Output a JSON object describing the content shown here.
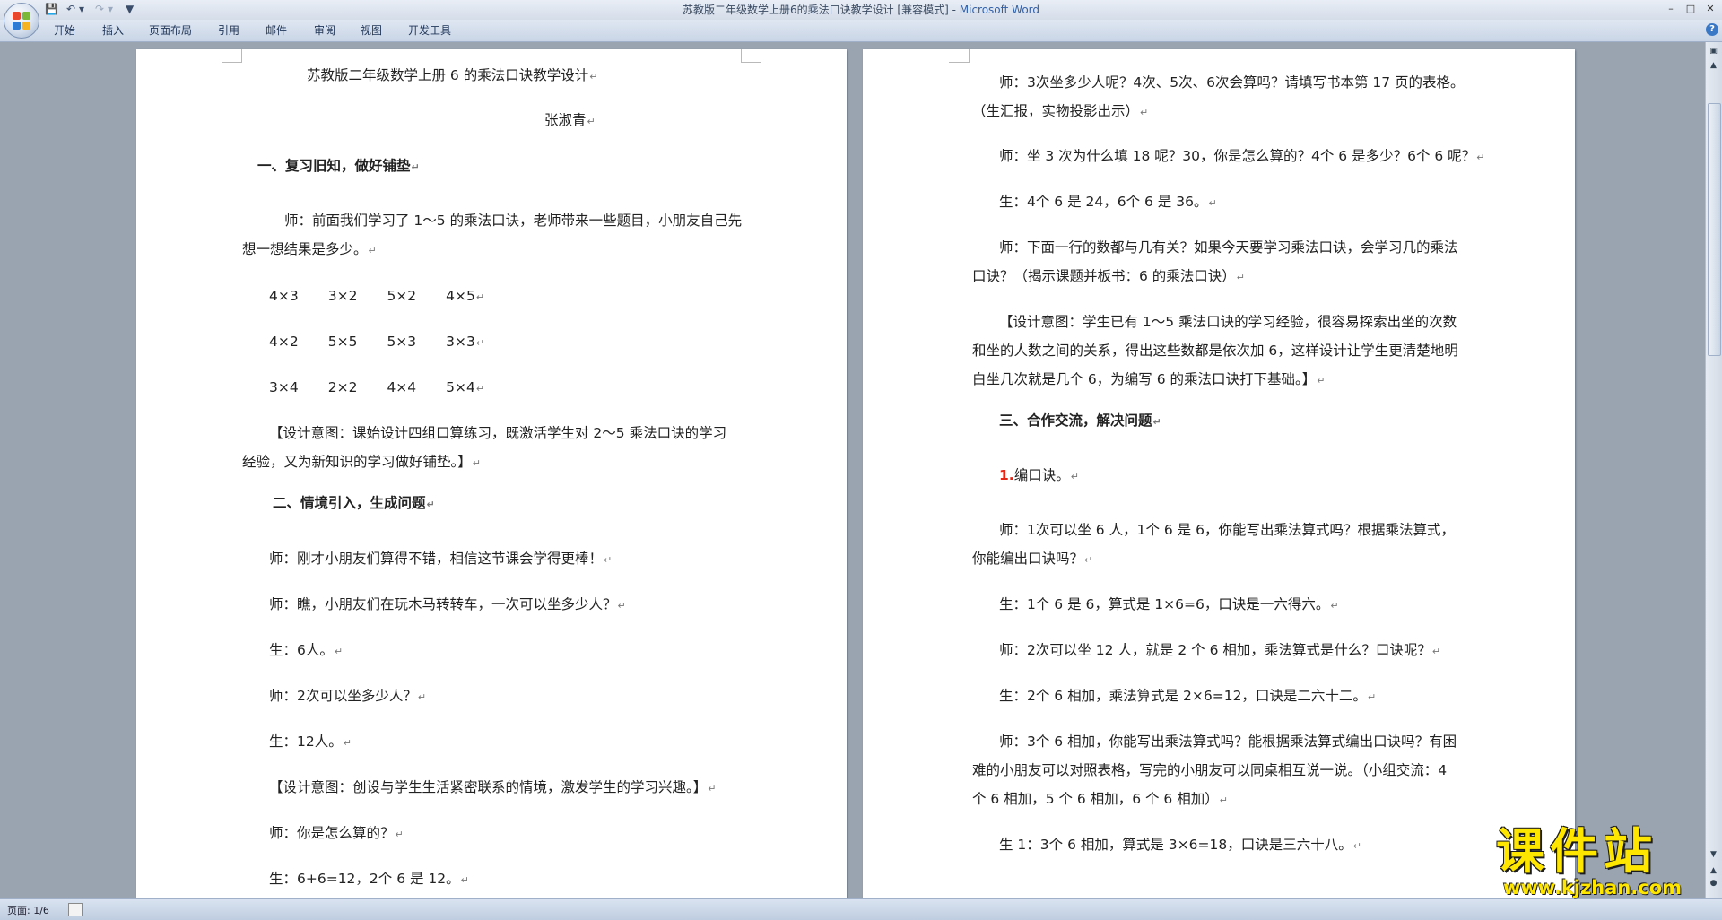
{
  "window": {
    "doc_title": "苏教版二年级数学上册6的乘法口诀教学设计 [兼容模式]",
    "separator": " - ",
    "app_name": "Microsoft Word"
  },
  "ribbon": {
    "tabs": [
      "开始",
      "插入",
      "页面布局",
      "引用",
      "邮件",
      "审阅",
      "视图",
      "开发工具"
    ]
  },
  "left_page": {
    "title": "苏教版二年级数学上册 6 的乘法口诀教学设计",
    "author": "张淑青",
    "h1": "一、复习旧知，做好铺垫",
    "p1a": "师：前面我们学习了 1～5 的乘法口诀，老师带来一些题目，小朋友自己先",
    "p1b": "想一想结果是多少。",
    "r1": [
      "4×3",
      "3×2",
      "5×2",
      "4×5"
    ],
    "r2": [
      "4×2",
      "5×5",
      "5×3",
      "3×3"
    ],
    "r3": [
      "3×4",
      "2×2",
      "4×4",
      "5×4"
    ],
    "d1a": "【设计意图：课始设计四组口算练习，既激活学生对 2～5 乘法口诀的学习",
    "d1b": "经验，又为新知识的学习做好铺垫。】",
    "h2": "二、情境引入，生成问题",
    "s1": "师：刚才小朋友们算得不错，相信这节课会学得更棒！",
    "s2": "师：瞧，小朋友们在玩木马转转车，一次可以坐多少人？",
    "s3": "生：6人。",
    "s4": "师：2次可以坐多少人？",
    "s5": "生：12人。",
    "d2": "【设计意图：创设与学生生活紧密联系的情境，激发学生的学习兴趣。】",
    "s6": "师：你是怎么算的？",
    "s7": "生：6+6=12，2个 6 是 12。"
  },
  "right_page": {
    "a1": "师：3次坐多少人呢？4次、5次、6次会算吗？请填写书本第 17 页的表格。",
    "a2": "（生汇报，实物投影出示）",
    "a3": "师：坐 3 次为什么填 18 呢？30，你是怎么算的？4个 6 是多少？6个 6 呢？",
    "a4": "生：4个 6 是 24，6个 6 是 36。",
    "a5": "师：下面一行的数都与几有关？如果今天要学习乘法口诀，会学习几的乘法",
    "a6": "口诀？（揭示课题并板书：6 的乘法口诀）",
    "a7": "【设计意图：学生已有 1～5 乘法口诀的学习经验，很容易探索出坐的次数",
    "a8": "和坐的人数之间的关系，得出这些数都是依次加 6，这样设计让学生更清楚地明",
    "a9": "白坐几次就是几个 6，为编写 6 的乘法口诀打下基础。】",
    "h3": "三、合作交流，解决问题",
    "n1": "1.",
    "n1t": "编口诀。",
    "b1": "师：1次可以坐 6 人，1个 6 是 6，你能写出乘法算式吗？根据乘法算式，",
    "b2": "你能编出口诀吗？",
    "b3": "生：1个 6 是 6，算式是 1×6=6，口诀是一六得六。",
    "b4": "师：2次可以坐 12 人，就是 2 个 6 相加，乘法算式是什么？口诀呢？",
    "b5": "生：2个 6 相加，乘法算式是 2×6=12，口诀是二六十二。",
    "b6": "师：3个 6 相加，你能写出乘法算式吗？能根据乘法算式编出口诀吗？有困",
    "b7": "难的小朋友可以对照表格，写完的小朋友可以同桌相互说一说。（小组交流：4",
    "b8": "个 6 相加，5 个 6 相加，6 个 6 相加）",
    "b9": "生 1：3个 6 相加，算式是 3×6=18，口诀是三六十八。"
  },
  "status_bar": {
    "page": "页面: 1/6"
  },
  "watermark": {
    "text": "课件站",
    "url": "www.kjzhan.com"
  },
  "colors": {
    "accent": "#2f5fa8",
    "watermark": "#ffe600",
    "numbering": "#e02818"
  }
}
